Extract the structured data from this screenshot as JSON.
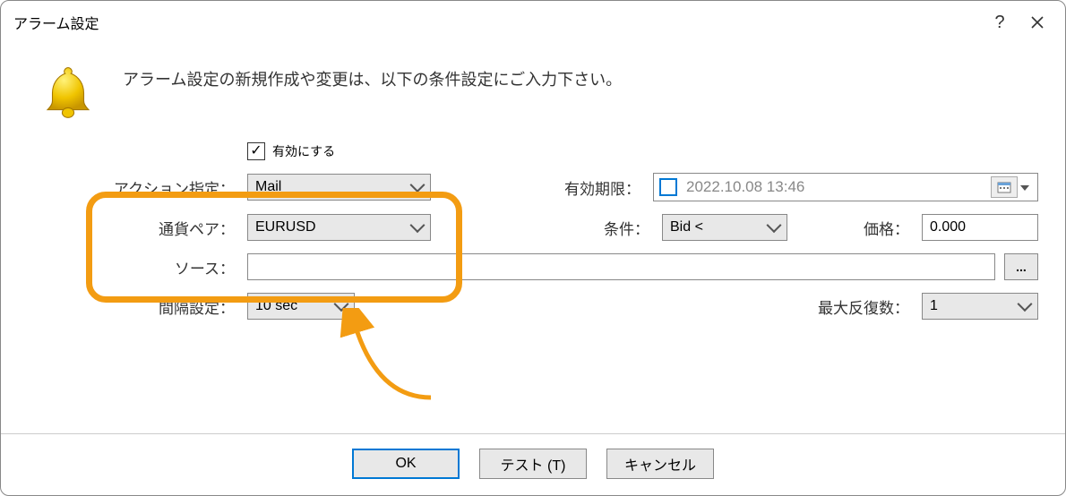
{
  "title": "アラーム設定",
  "intro": "アラーム設定の新規作成や変更は、以下の条件設定にご入力下さい。",
  "enable": {
    "label": "有効にする",
    "checked": true
  },
  "labels": {
    "action": "アクション指定：",
    "pair": "通貨ペア：",
    "source": "ソース：",
    "interval": "間隔設定：",
    "expiration": "有効期限：",
    "condition": "条件：",
    "price": "価格：",
    "maxIterations": "最大反復数："
  },
  "values": {
    "action": "Mail",
    "pair": "EURUSD",
    "source": "",
    "interval": "10 sec",
    "expiration": "2022.10.08 13:46",
    "condition": "Bid <",
    "price": "0.000",
    "maxIterations": "1"
  },
  "buttons": {
    "ok": "OK",
    "test": "テスト (T)",
    "cancel": "キャンセル",
    "browse": "..."
  }
}
